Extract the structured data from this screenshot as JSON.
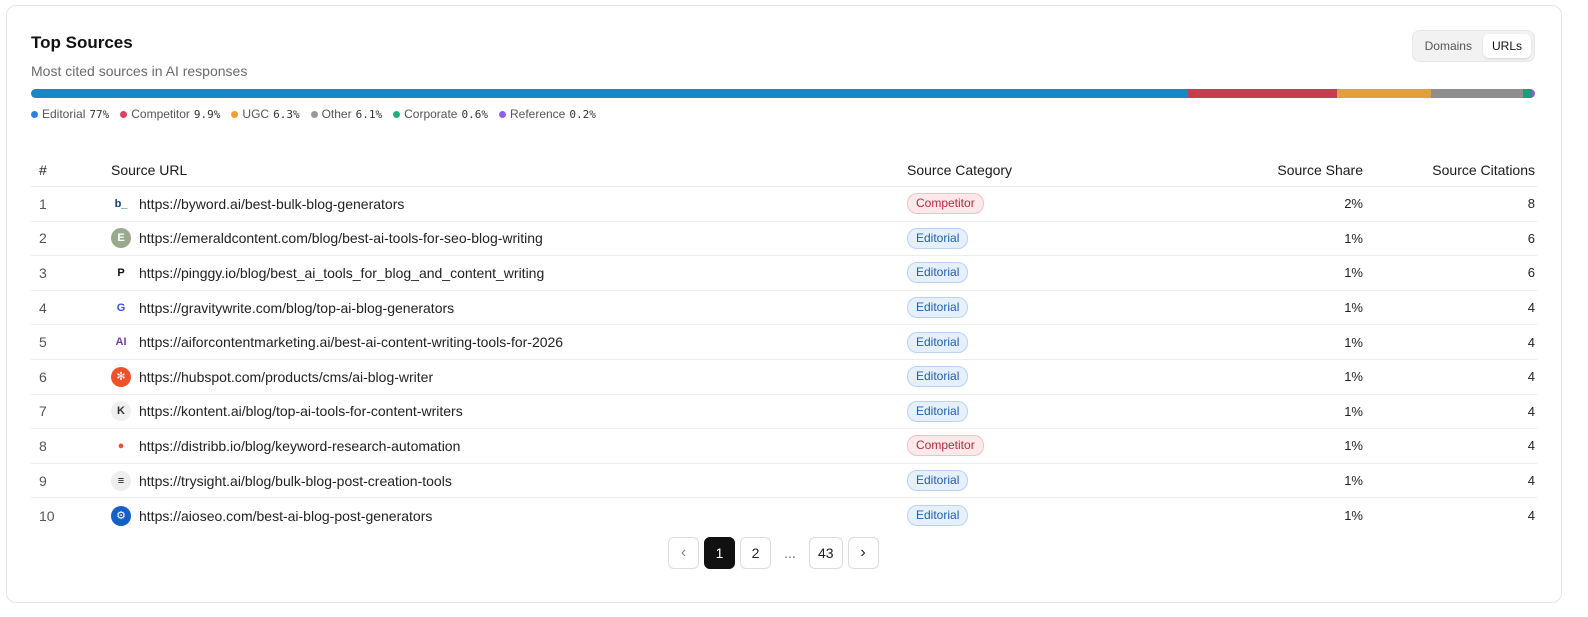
{
  "header": {
    "title": "Top Sources",
    "subtitle": "Most cited sources in AI responses"
  },
  "view_toggle": {
    "options": [
      "Domains",
      "URLs"
    ],
    "selected": "URLs"
  },
  "category_distribution": [
    {
      "name": "Editorial",
      "pct_label": "77%",
      "value": 77,
      "color": "#1a87c4"
    },
    {
      "name": "Competitor",
      "pct_label": "9.9%",
      "value": 9.9,
      "color": "#c24050"
    },
    {
      "name": "UGC",
      "pct_label": "6.3%",
      "value": 6.3,
      "color": "#e0a040"
    },
    {
      "name": "Other",
      "pct_label": "6.1%",
      "value": 6.1,
      "color": "#8e8e8e"
    },
    {
      "name": "Corporate",
      "pct_label": "0.6%",
      "value": 0.6,
      "color": "#18a078"
    },
    {
      "name": "Reference",
      "pct_label": "0.2%",
      "value": 0.2,
      "color": "#8a5cd6"
    }
  ],
  "legend_dot_colors": {
    "Editorial": "#2f7fe0",
    "Competitor": "#e0405f",
    "UGC": "#f0a030",
    "Other": "#9a9a9a",
    "Corporate": "#20b080",
    "Reference": "#9060e0"
  },
  "table": {
    "columns": [
      "#",
      "Source URL",
      "Source Category",
      "Source Share",
      "Source Citations"
    ],
    "rows": [
      {
        "num": "1",
        "url": "https://byword.ai/best-bulk-blog-generators",
        "category": "Competitor",
        "share": "2%",
        "citations": "8",
        "icon": "byword-icon",
        "glyph": "b_",
        "icon_bg": "#ffffff",
        "icon_fg": "#0f3f78"
      },
      {
        "num": "2",
        "url": "https://emeraldcontent.com/blog/best-ai-tools-for-seo-blog-writing",
        "category": "Editorial",
        "share": "1%",
        "citations": "6",
        "icon": "emeraldcontent-icon",
        "glyph": "E",
        "icon_bg": "#9aa88e",
        "icon_fg": "#ffffff"
      },
      {
        "num": "3",
        "url": "https://pinggy.io/blog/best_ai_tools_for_blog_and_content_writing",
        "category": "Editorial",
        "share": "1%",
        "citations": "6",
        "icon": "pinggy-icon",
        "glyph": "P",
        "icon_bg": "#ffffff",
        "icon_fg": "#111111"
      },
      {
        "num": "4",
        "url": "https://gravitywrite.com/blog/top-ai-blog-generators",
        "category": "Editorial",
        "share": "1%",
        "citations": "4",
        "icon": "gravitywrite-icon",
        "glyph": "G",
        "icon_bg": "#ffffff",
        "icon_fg": "#3a4fd8"
      },
      {
        "num": "5",
        "url": "https://aiforcontentmarketing.ai/best-ai-content-writing-tools-for-2026",
        "category": "Editorial",
        "share": "1%",
        "citations": "4",
        "icon": "aiforcontentmarketing-icon",
        "glyph": "AI",
        "icon_bg": "#ffffff",
        "icon_fg": "#7040a8"
      },
      {
        "num": "6",
        "url": "https://hubspot.com/products/cms/ai-blog-writer",
        "category": "Editorial",
        "share": "1%",
        "citations": "4",
        "icon": "hubspot-icon",
        "glyph": "✻",
        "icon_bg": "#f0502a",
        "icon_fg": "#ffffff"
      },
      {
        "num": "7",
        "url": "https://kontent.ai/blog/top-ai-tools-for-content-writers",
        "category": "Editorial",
        "share": "1%",
        "citations": "4",
        "icon": "kontent-icon",
        "glyph": "K",
        "icon_bg": "#f0f0f0",
        "icon_fg": "#333333"
      },
      {
        "num": "8",
        "url": "https://distribb.io/blog/keyword-research-automation",
        "category": "Competitor",
        "share": "1%",
        "citations": "4",
        "icon": "distribb-icon",
        "glyph": "●",
        "icon_bg": "#ffffff",
        "icon_fg": "#e85040"
      },
      {
        "num": "9",
        "url": "https://trysight.ai/blog/bulk-blog-post-creation-tools",
        "category": "Editorial",
        "share": "1%",
        "citations": "4",
        "icon": "trysight-icon",
        "glyph": "≡",
        "icon_bg": "#eeeeee",
        "icon_fg": "#111111"
      },
      {
        "num": "10",
        "url": "https://aioseo.com/best-ai-blog-post-generators",
        "category": "Editorial",
        "share": "1%",
        "citations": "4",
        "icon": "aioseo-icon",
        "glyph": "⚙",
        "icon_bg": "#1360c8",
        "icon_fg": "#ffffff"
      }
    ]
  },
  "pagination": {
    "prev_icon": "chevron-left-icon",
    "next_icon": "chevron-right-icon",
    "prev_glyph": "‹",
    "next_glyph": "›",
    "pages": [
      "1",
      "2",
      "...",
      "43"
    ],
    "current": "1"
  }
}
